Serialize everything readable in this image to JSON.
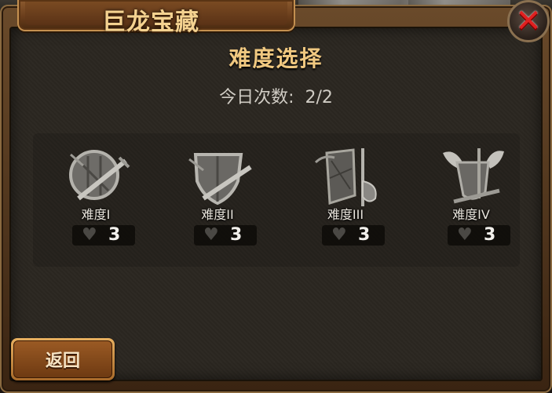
{
  "window": {
    "title": "巨龙宝藏"
  },
  "header": {
    "heading": "难度选择",
    "daily_label": "今日次数:",
    "daily_value": "2/2"
  },
  "difficulties": [
    {
      "label": "难度I",
      "cost": "3",
      "icon": "shield-sword-icon"
    },
    {
      "label": "难度II",
      "cost": "3",
      "icon": "kite-shield-sword-icon"
    },
    {
      "label": "难度III",
      "cost": "3",
      "icon": "banner-axe-icon"
    },
    {
      "label": "难度IV",
      "cost": "3",
      "icon": "winged-shield-icon"
    }
  ],
  "cost_icon": "heart-icon",
  "footer": {
    "back_label": "返回"
  },
  "colors": {
    "title": "#f4d290",
    "heading": "#f0c880",
    "close": "#e02020",
    "button": "#9a5a24"
  }
}
